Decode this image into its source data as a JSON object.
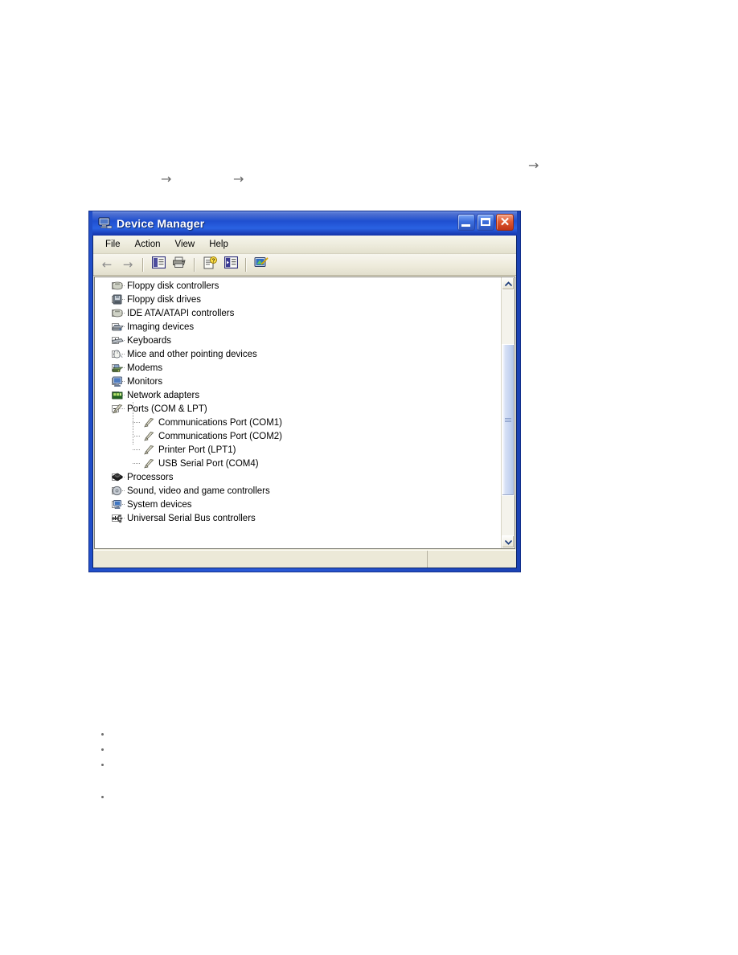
{
  "window": {
    "title": "Device Manager",
    "title_icon": "computer-monitor-icon",
    "buttons": {
      "minimize": "_",
      "maximize": "□",
      "close": "✕"
    }
  },
  "menu": {
    "items": [
      {
        "label": "File"
      },
      {
        "label": "Action"
      },
      {
        "label": "View"
      },
      {
        "label": "Help"
      }
    ]
  },
  "toolbar": {
    "buttons": [
      {
        "name": "back-arrow",
        "glyph": "←"
      },
      {
        "name": "forward-arrow",
        "glyph": "→"
      },
      {
        "name": "show-hide-console-tree",
        "glyph": ""
      },
      {
        "name": "print",
        "glyph": ""
      },
      {
        "name": "properties",
        "glyph": ""
      },
      {
        "name": "scan-for-hardware-changes",
        "glyph": ""
      },
      {
        "name": "update-driver",
        "glyph": ""
      }
    ]
  },
  "tree": {
    "items": [
      {
        "label": "Floppy disk controllers",
        "level": 1,
        "state": "collapsed",
        "icon": "floppy-disk-controller-icon"
      },
      {
        "label": "Floppy disk drives",
        "level": 1,
        "state": "collapsed",
        "icon": "floppy-disk-drive-icon"
      },
      {
        "label": "IDE ATA/ATAPI controllers",
        "level": 1,
        "state": "collapsed",
        "icon": "ide-controller-icon"
      },
      {
        "label": "Imaging devices",
        "level": 1,
        "state": "collapsed",
        "icon": "imaging-device-icon"
      },
      {
        "label": "Keyboards",
        "level": 1,
        "state": "collapsed",
        "icon": "keyboard-icon"
      },
      {
        "label": "Mice and other pointing devices",
        "level": 1,
        "state": "collapsed",
        "icon": "mouse-icon"
      },
      {
        "label": "Modems",
        "level": 1,
        "state": "collapsed",
        "icon": "modem-icon"
      },
      {
        "label": "Monitors",
        "level": 1,
        "state": "collapsed",
        "icon": "monitor-icon"
      },
      {
        "label": "Network adapters",
        "level": 1,
        "state": "collapsed",
        "icon": "network-adapter-icon"
      },
      {
        "label": "Ports (COM & LPT)",
        "level": 1,
        "state": "expanded",
        "icon": "port-icon"
      },
      {
        "label": "Communications Port (COM1)",
        "level": 2,
        "state": "leaf",
        "icon": "port-icon"
      },
      {
        "label": "Communications Port (COM2)",
        "level": 2,
        "state": "leaf",
        "icon": "port-icon"
      },
      {
        "label": "Printer Port (LPT1)",
        "level": 2,
        "state": "leaf",
        "icon": "port-icon"
      },
      {
        "label": "USB Serial Port (COM4)",
        "level": 2,
        "state": "leaf",
        "icon": "port-icon"
      },
      {
        "label": "Processors",
        "level": 1,
        "state": "collapsed",
        "icon": "processor-icon"
      },
      {
        "label": "Sound, video and game controllers",
        "level": 1,
        "state": "collapsed",
        "icon": "sound-controller-icon"
      },
      {
        "label": "System devices",
        "level": 1,
        "state": "collapsed",
        "icon": "system-device-icon"
      },
      {
        "label": "Universal Serial Bus controllers",
        "level": 1,
        "state": "collapsed",
        "icon": "usb-controller-icon"
      }
    ]
  },
  "scrollbar": {
    "up_arrow": "▲",
    "down_arrow": "▼",
    "thumb_top_percent": 22,
    "thumb_height_percent": 62
  },
  "status_bar": {
    "main_text": "",
    "secondary_text": ""
  },
  "page_arrows": [
    {
      "glyph": "→"
    },
    {
      "glyph": "→"
    },
    {
      "glyph": "→"
    }
  ],
  "page_bullets": [
    {
      "text": ""
    },
    {
      "text": ""
    },
    {
      "text": ""
    },
    {
      "text": ""
    }
  ],
  "colors": {
    "title_bar_blue": "#1b46c4",
    "window_frame_blue": "#204ec9",
    "client_bg": "#ece9d8",
    "tree_bg": "#ffffff",
    "close_button_red": "#e05a32",
    "scrollbar_thumb": "#c3d2f0"
  }
}
